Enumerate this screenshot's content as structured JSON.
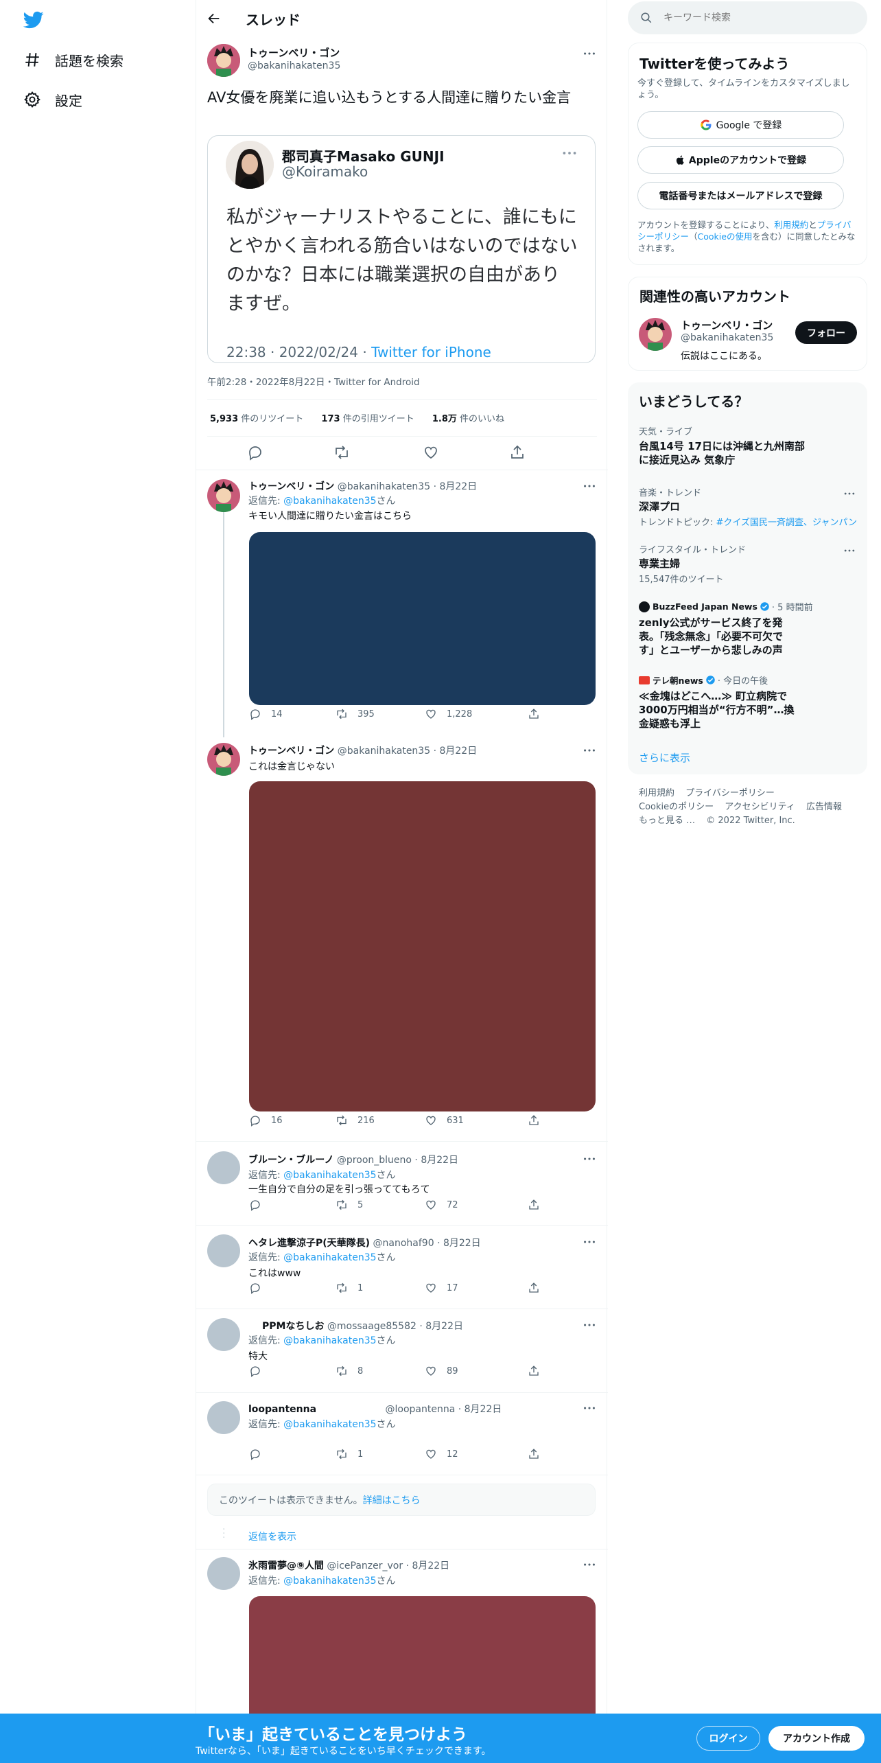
{
  "nav": {
    "explore_label": "話題を検索",
    "settings_label": "設定"
  },
  "header": {
    "title": "スレッド"
  },
  "main_tweet": {
    "name": "トゥーンベリ・ゴン",
    "handle": "@bakanihakaten35",
    "text": "AV女優を廃業に追い込もうとする人間達に贈りたい金言",
    "quote": {
      "name": "郡司真子Masako GUNJI",
      "handle": "@Koiramako",
      "text": "私がジャーナリストやることに、誰にもにとやかく言われる筋合いはないのではないのかな？日本には職業選択の自由がありますぜ。",
      "time": "22:38 · 2022/02/24 · ",
      "source": "Twitter for iPhone"
    },
    "timestamp": "午前2:28・2022年8月22日・Twitter for Android",
    "stats": {
      "retweets_count": "5,933",
      "retweets_label": "件のリツイート",
      "quotes_count": "173",
      "quotes_label": "件の引用ツイート",
      "likes_count": "1.8万",
      "likes_label": "件のいいね"
    }
  },
  "replies": [
    {
      "name": "トゥーンベリ・ゴン",
      "handle": "@bakanihakaten35",
      "date": "· 8月22日",
      "reply_prefix": "返信先: ",
      "reply_to": "@bakanihakaten35",
      "reply_suffix": "さん",
      "text": "キモい人間達に贈りたい金言はこちら",
      "media_color": "#1b3a5c",
      "replies": "14",
      "retweets": "395",
      "likes": "1,228"
    },
    {
      "name": "トゥーンベリ・ゴン",
      "handle": "@bakanihakaten35",
      "date": "· 8月22日",
      "text": "これは金言じゃない",
      "media_color": "#743535",
      "replies": "16",
      "retweets": "216",
      "likes": "631"
    },
    {
      "name": "ブルーン・ブルーノ",
      "handle": "@proon_blueno",
      "date": "· 8月22日",
      "reply_prefix": "返信先: ",
      "reply_to": "@bakanihakaten35",
      "reply_suffix": "さん",
      "text": "一生自分で自分の足を引っ張っててもろて",
      "replies": "",
      "retweets": "5",
      "likes": "72"
    },
    {
      "name": "ヘタレ進撃涼子P(天華隊長)",
      "handle": "@nanohaf90",
      "date": "· 8月22日",
      "reply_prefix": "返信先: ",
      "reply_to": "@bakanihakaten35",
      "reply_suffix": "さん",
      "text": "これはwww",
      "replies": "",
      "retweets": "1",
      "likes": "17"
    },
    {
      "name": "PPMなちしお",
      "handle": "@mossaage85582",
      "date": "· 8月22日",
      "reply_prefix": "返信先: ",
      "reply_to": "@bakanihakaten35",
      "reply_suffix": "さん",
      "text": "特大",
      "replies": "",
      "retweets": "8",
      "likes": "89"
    },
    {
      "name": "loopantenna",
      "handle": "@loopantenna",
      "date": "· 8月22日",
      "reply_prefix": "返信先: ",
      "reply_to": "@bakanihakaten35",
      "reply_suffix": "さん",
      "text": "",
      "replies": "",
      "retweets": "1",
      "likes": "12"
    },
    {
      "name": "氷雨雷夢@⑨人間",
      "handle": "@icePanzer_vor",
      "date": "· 8月22日",
      "reply_prefix": "返信先: ",
      "reply_to": "@bakanihakaten35",
      "reply_suffix": "さん",
      "media_color": "#8a3d46"
    }
  ],
  "unavailable": {
    "text": "このツイートは表示できません。",
    "link": "詳細はこちら"
  },
  "show_replies": "返信を表示",
  "search": {
    "placeholder": "キーワード検索"
  },
  "signup": {
    "title": "Twitterを使ってみよう",
    "subtitle": "今すぐ登録して、タイムラインをカスタマイズしましょう。",
    "google_label": "Google で登録",
    "apple_label": "Appleのアカウントで登録",
    "phone_label": "電話番号またはメールアドレスで登録",
    "terms_prefix": "アカウントを登録することにより、",
    "terms_link": "利用規約",
    "terms_and": "と",
    "privacy_link": "プライバシーポリシー",
    "terms_paren_open": "（",
    "cookie_link": "Cookieの使用",
    "terms_suffix": "を含む）に同意したとみなされます。"
  },
  "related": {
    "title": "関連性の高いアカウント",
    "name": "トゥーンベリ・ゴン",
    "handle": "@bakanihakaten35",
    "bio": "伝説はここにある。",
    "follow_label": "フォロー"
  },
  "trends": {
    "title": "いまどうしてる？",
    "items": [
      {
        "category": "天気・ライブ",
        "title": "台風14号 17日には沖縄と九州南部に接近見込み 気象庁"
      },
      {
        "category": "音楽・トレンド",
        "title": "深澤プロ",
        "sub_prefix": "トレンドトピック: ",
        "sub_link": "#クイズ国民一斉調査、ジャンパン"
      },
      {
        "category": "ライフスタイル・トレンド",
        "title": "専業主婦",
        "sub": "15,547件のツイート"
      },
      {
        "source": "BuzzFeed Japan News",
        "time": "· 5 時間前",
        "title": "zenly公式がサービス終了を発表。「残念無念」「必要不可欠です」とユーザーから悲しみの声"
      },
      {
        "source": "テレ朝news",
        "time": "· 今日の午後",
        "title": "≪金塊はどこへ…≫ 町立病院で3000万円相当が“行方不明”…換金疑惑も浮上"
      }
    ],
    "more": "さらに表示"
  },
  "footer": {
    "terms": "利用規約",
    "privacy": "プライバシーポリシー",
    "cookie": "Cookieのポリシー",
    "accessibility": "アクセシビリティ",
    "ads": "広告情報",
    "more": "もっと見る …",
    "copyright": "© 2022 Twitter, Inc."
  },
  "bottom": {
    "title": "「いま」起きていることを見つけよう",
    "subtitle": "Twitterなら、「いま」起きていることをいち早くチェックできます。",
    "login_label": "ログイン",
    "signup_label": "アカウント作成"
  },
  "colors": {
    "accent": "#1d9bf0",
    "text": "#0f1419",
    "secondary": "#536471"
  }
}
